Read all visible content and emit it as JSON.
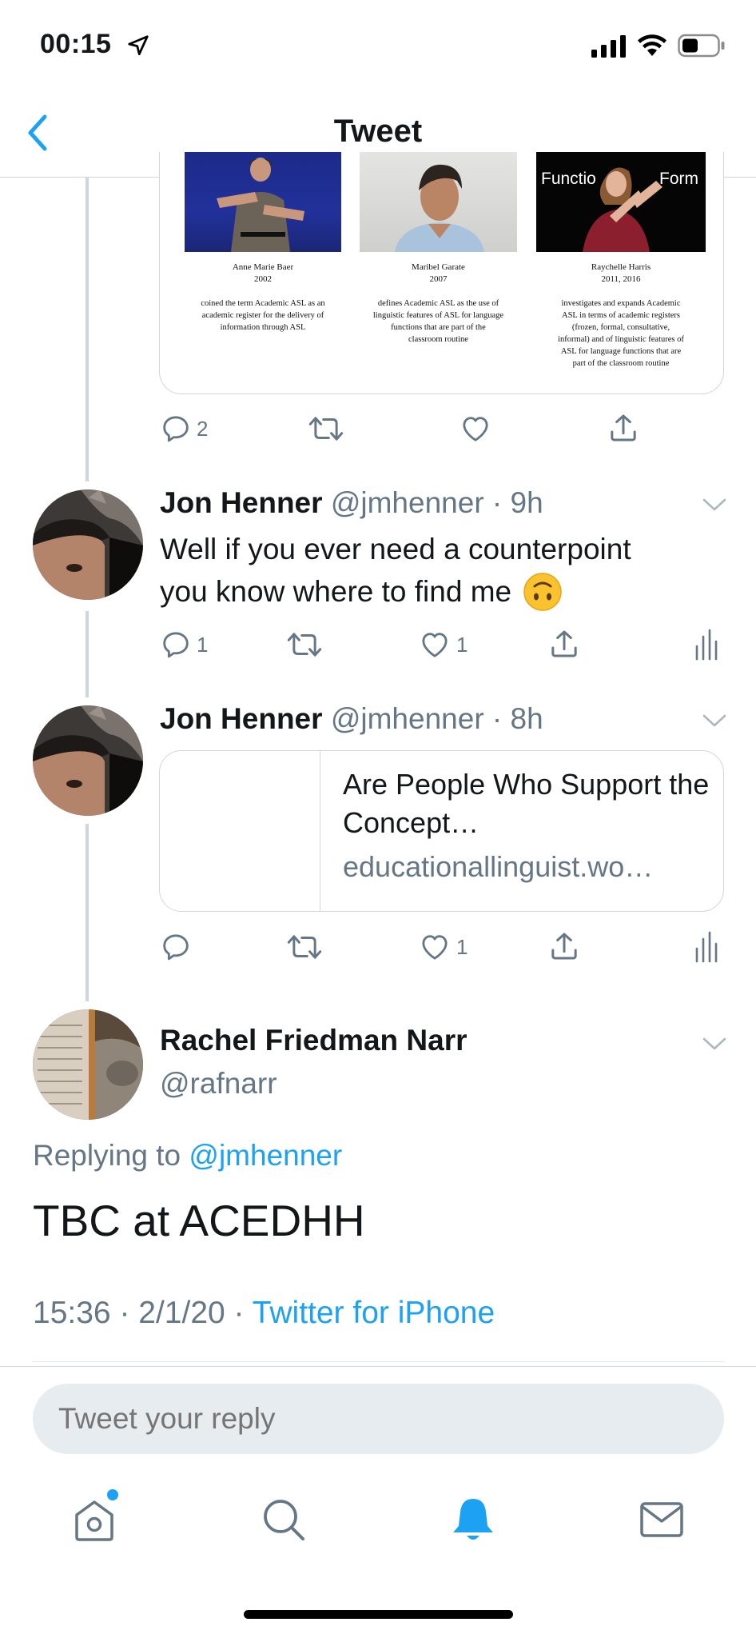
{
  "status_bar": {
    "time": "00:15"
  },
  "nav": {
    "title": "Tweet"
  },
  "media_card": {
    "photo3_label_left": "Functio",
    "photo3_label_right": "Form",
    "people": [
      {
        "name": "Anne Marie Baer",
        "year": "2002",
        "desc_1": "coined the term Academic ASL as an",
        "desc_2": "academic register for the delivery of",
        "desc_3": "information through ASL"
      },
      {
        "name": "Maribel Garate",
        "year": "2007",
        "desc_1": "defines Academic ASL as the use of",
        "desc_2": "linguistic features of ASL for language",
        "desc_3": "functions that are part of the",
        "desc_4": "classroom routine"
      },
      {
        "name": "Raychelle Harris",
        "year": "2011, 2016",
        "desc_1": "investigates and expands Academic",
        "desc_2": "ASL in terms of academic registers",
        "desc_3": "(frozen, formal, consultative,",
        "desc_4": "informal) and of linguistic features of",
        "desc_5": "ASL for language functions that are",
        "desc_6": "part of the classroom routine"
      }
    ]
  },
  "tweet0": {
    "reply_count": "2"
  },
  "tweet1": {
    "name": "Jon Henner",
    "meta": "@jmhenner · 9h",
    "text_line1": "Well if you ever need a counterpoint",
    "text_line2": "you know where to find me",
    "reply_count": "1",
    "like_count": "1"
  },
  "tweet2": {
    "name": "Jon Henner",
    "meta": "@jmhenner · 8h",
    "link_title": "Are People Who Support the Concept…",
    "link_domain": "educationallinguist.wo…",
    "like_count": "1"
  },
  "focus": {
    "name": "Rachel Friedman Narr",
    "handle": "@rafnarr",
    "replying_prefix": "Replying to",
    "replying_handle": "@jmhenner",
    "text": "TBC at ACEDHH",
    "time": "15:36",
    "date": "2/1/20",
    "source": "Twitter for iPhone"
  },
  "reply_box": {
    "placeholder": "Tweet your reply"
  },
  "colors": {
    "accent": "#1da1f2",
    "secondary_text": "#657786",
    "divider": "#e1e8ed"
  },
  "icons": {
    "status": [
      "location-arrow-icon",
      "signal-icon",
      "wifi-icon",
      "battery-icon"
    ],
    "nav": [
      "back-chevron-icon"
    ],
    "actions": [
      "reply-icon",
      "retweet-icon",
      "like-icon",
      "share-icon",
      "analytics-icon"
    ],
    "tabs": [
      "home-icon",
      "search-icon",
      "notifications-bell-icon",
      "messages-icon"
    ]
  }
}
